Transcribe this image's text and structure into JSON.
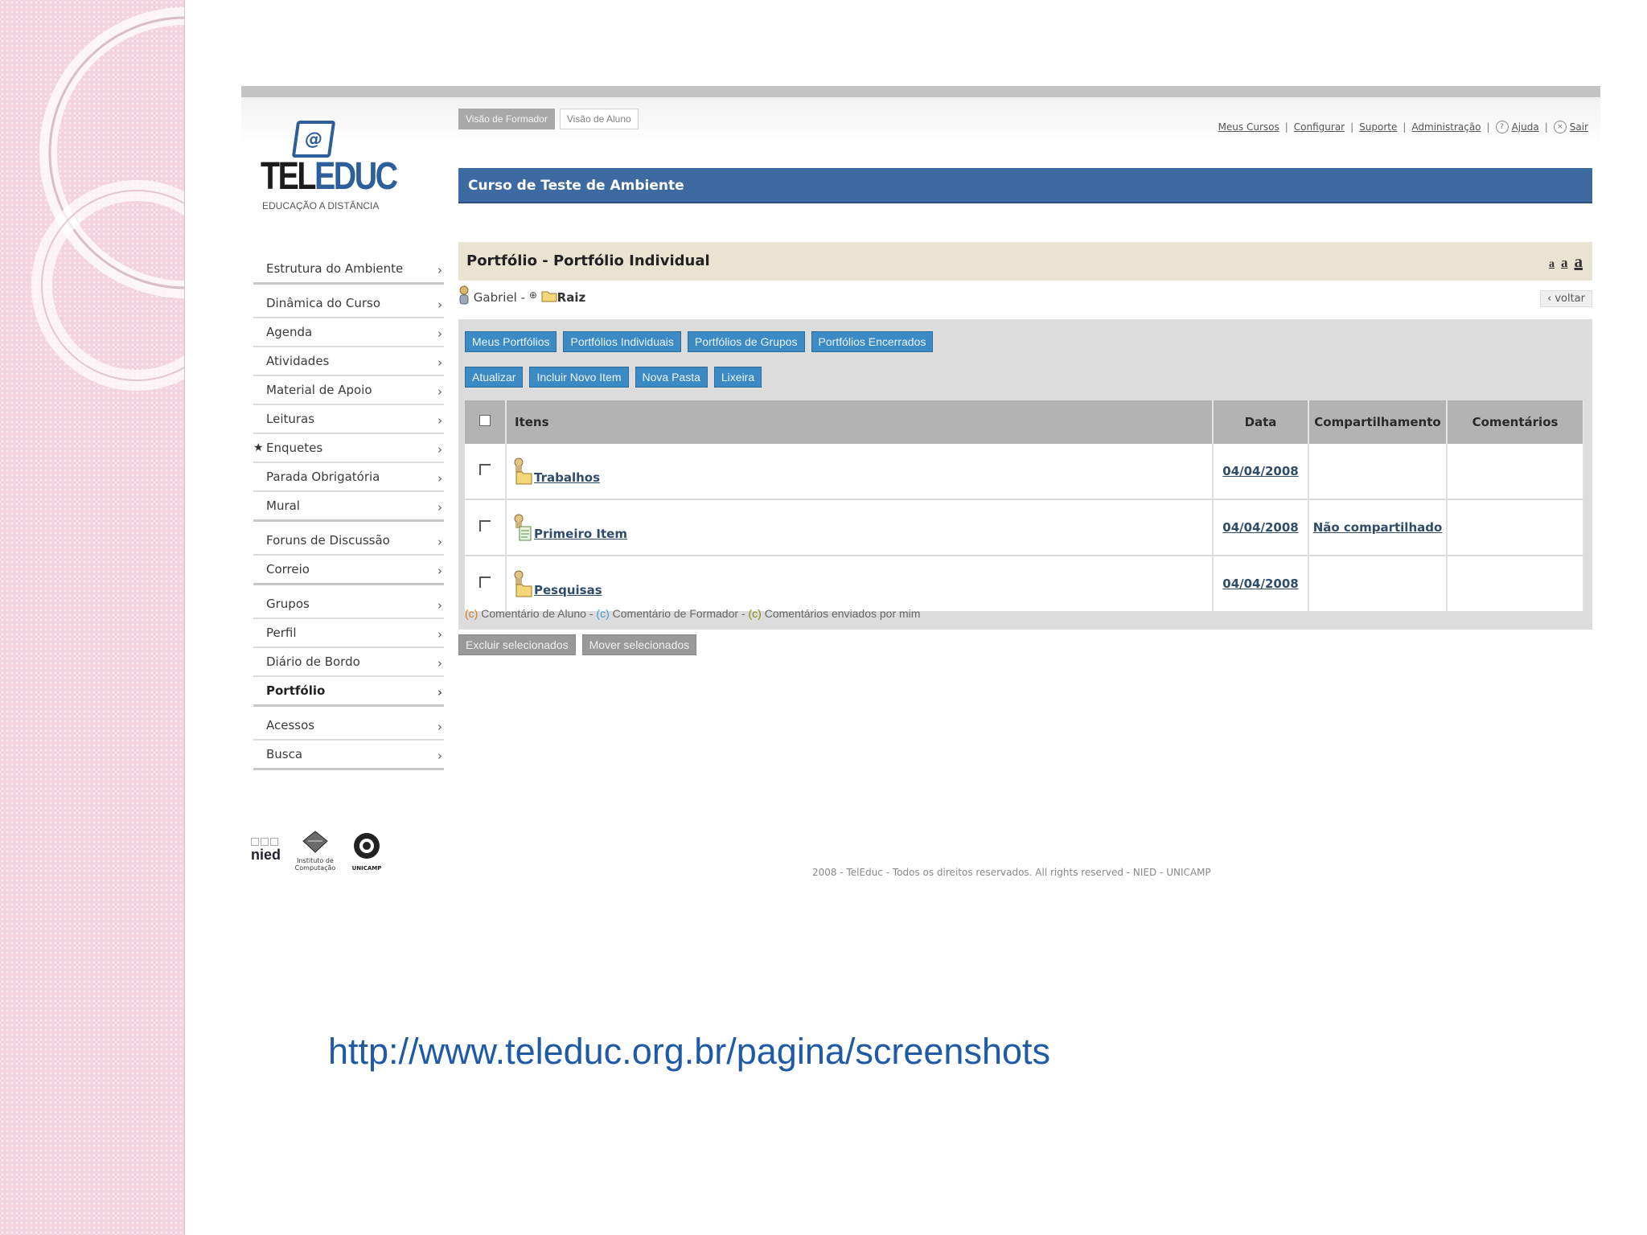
{
  "header": {
    "view_tabs": [
      "Visão de Formador",
      "Visão de Aluno"
    ],
    "links": [
      "Meus Cursos",
      "Configurar",
      "Suporte",
      "Administração",
      "Ajuda",
      "Sair"
    ],
    "course_title": "Curso de Teste de Ambiente"
  },
  "logo": {
    "tel": "TEL",
    "educ": "EDUC",
    "subtitle": "EDUCAÇÃO A DISTÂNCIA"
  },
  "sidebar": {
    "groups": [
      [
        "Estrutura do Ambiente"
      ],
      [
        "Dinâmica do Curso",
        "Agenda",
        "Atividades",
        "Material de Apoio",
        "Leituras",
        "Enquetes",
        "Parada Obrigatória",
        "Mural"
      ],
      [
        "Foruns de Discussão",
        "Correio"
      ],
      [
        "Grupos",
        "Perfil",
        "Diário de Bordo",
        "Portfólio"
      ],
      [
        "Acessos",
        "Busca"
      ]
    ]
  },
  "section": {
    "title": "Portfólio - Portfólio Individual",
    "font_sizes": [
      "a",
      "a",
      "a"
    ]
  },
  "breadcrumb": {
    "user": "Gabriel -",
    "root": "Raiz",
    "back": "‹ voltar"
  },
  "buttons": {
    "row1": [
      "Meus Portfólios",
      "Portfólios Individuais",
      "Portfólios de Grupos",
      "Portfólios Encerrados"
    ],
    "row2": [
      "Atualizar",
      "Incluir Novo Item",
      "Nova Pasta",
      "Lixeira"
    ],
    "bottom": [
      "Excluir selecionados",
      "Mover selecionados"
    ]
  },
  "table": {
    "headers": [
      "Itens",
      "Data",
      "Compartilhamento",
      "Comentários"
    ],
    "rows": [
      {
        "name": "Trabalhos",
        "type": "folder",
        "date": "04/04/2008",
        "share": "",
        "comments": ""
      },
      {
        "name": "Primeiro Item",
        "type": "item",
        "date": "04/04/2008",
        "share": "Não compartilhado",
        "comments": ""
      },
      {
        "name": "Pesquisas",
        "type": "folder",
        "date": "04/04/2008",
        "share": "",
        "comments": ""
      }
    ]
  },
  "legend": {
    "c": "(c)",
    "aluno": " Comentário de Aluno - ",
    "formador": " Comentário de Formador - ",
    "mim": " Comentários enviados por mim"
  },
  "partners": {
    "nied": "nied",
    "ic": "Instituto de Computação",
    "unicamp": "UNICAMP"
  },
  "footer": "2008 - TelEduc - Todos os direitos reservados. All rights reserved - NIED - UNICAMP",
  "slide_url": "http://www.teleduc.org.br/pagina/screenshots"
}
